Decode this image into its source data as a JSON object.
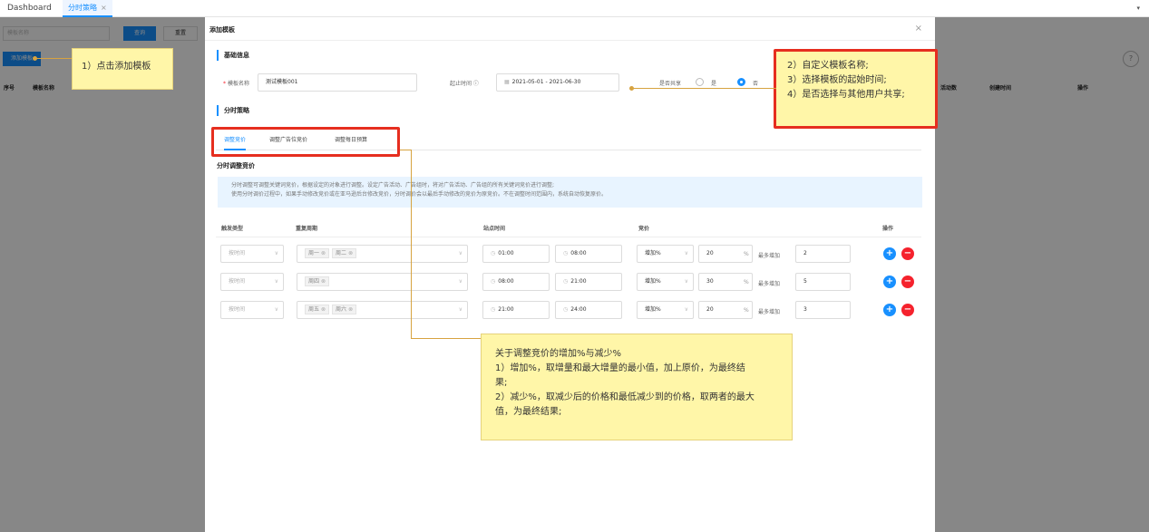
{
  "topbar": {
    "tab1": "Dashboard",
    "tab2": "分时策略",
    "tab2_close": "×",
    "dropdown": "▾"
  },
  "background": {
    "search_placeholder": "模板名称",
    "query_button": "查询",
    "reset_button": "重置",
    "add_button": "添加模板",
    "columns": [
      "序号",
      "模板名称",
      "活动数",
      "创建时间",
      "操作"
    ],
    "help": "?"
  },
  "modal": {
    "title": "添加模板",
    "close": "×",
    "basic_info_title": "基础信息",
    "name_label": "模板名称",
    "name_required_mark": "*",
    "name_value": "测试模板001",
    "period_label": "起止时间 ⓘ",
    "period_value": "2021-05-01  -  2021-06-30",
    "share_label": "是否共享",
    "share_yes": "是",
    "share_no": "否",
    "share_selected": "否",
    "strategy_title": "分时策略",
    "tabs": [
      "调整竞价",
      "调整广告位竞价",
      "调整每日预算"
    ],
    "active_tab": "调整竞价",
    "sub_title": "分时调整竞价",
    "info_line1": "分时调整可调整关键词竞价，根据设定的对象进行调整。设定广告活动、广告组时，将对广告活动、广告组的所有关键词竞价进行调整;",
    "info_line2": "使用分时调价过程中，如果手动修改竞价或在亚马逊后台修改竞价，分时调价会以最后手动修改的竞价为原竞价。不在调整时间范围内，系统自动恢复原价。",
    "table_headers": {
      "trigger": "触发类型",
      "cycle": "重复周期",
      "time": "站点时间",
      "bid": "竞价",
      "op": "操作"
    },
    "rows": [
      {
        "trigger": "按时间",
        "days": [
          "周一",
          "周二"
        ],
        "start": "01:00",
        "end": "08:00",
        "mode": "增加%",
        "amount": "20",
        "pct": "%",
        "max_label": "最多增加",
        "max_value": "2"
      },
      {
        "trigger": "按时间",
        "days": [
          "周四"
        ],
        "start": "08:00",
        "end": "21:00",
        "mode": "增加%",
        "amount": "30",
        "pct": "%",
        "max_label": "最多增加",
        "max_value": "5"
      },
      {
        "trigger": "按时间",
        "days": [
          "周五",
          "周六"
        ],
        "start": "21:00",
        "end": "24:00",
        "mode": "增加%",
        "amount": "20",
        "pct": "%",
        "max_label": "最多增加",
        "max_value": "3"
      }
    ]
  },
  "callouts": {
    "c1": "1）点击添加模板",
    "c2_lines": [
      "2）自定义模板名称;",
      "3）选择模板的起始时间;",
      "4）是否选择与其他用户共享;"
    ],
    "c3_lines": [
      "关于调整竞价的增加%与减少%",
      "1）增加%，取增量和最大增量的最小值，加上原价，为最终结",
      "果;",
      "2）减少%，取减少后的价格和最低减少到的价格，取两者的最大",
      "值，为最终结果;"
    ]
  },
  "colors": {
    "accent": "#1890ff",
    "danger": "#f5222d",
    "callout_bg": "#fff6a8",
    "highlight": "#e62e1f"
  }
}
